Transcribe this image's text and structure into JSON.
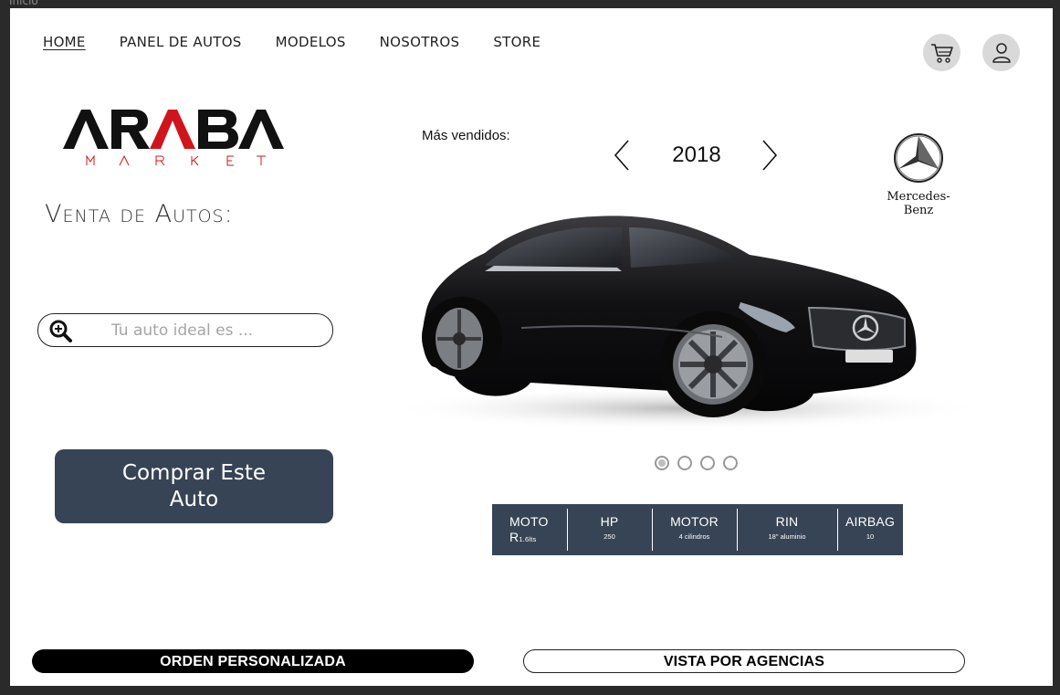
{
  "frame": {
    "label": "Inicio"
  },
  "nav": {
    "items": [
      {
        "label": "HOME",
        "active": true
      },
      {
        "label": "PANEL DE AUTOS",
        "active": false
      },
      {
        "label": "MODELOS",
        "active": false
      },
      {
        "label": "NOSOTROS",
        "active": false
      },
      {
        "label": "STORE",
        "active": false
      }
    ],
    "cart_icon": "cart-icon",
    "user_icon": "user-icon"
  },
  "logo": {
    "main": "ARABA",
    "sub": "MARKET",
    "accent_color": "#d0141b"
  },
  "hero": {
    "heading": "Venta de Autos:"
  },
  "search": {
    "placeholder": "Tu auto ideal es ...",
    "icon": "search-icon"
  },
  "buy_button": {
    "label": "Comprar Este Auto"
  },
  "carousel": {
    "section_label": "Más vendidos:",
    "year": "2018",
    "brand": "Mercedes-Benz",
    "dots": [
      true,
      false,
      false,
      false
    ]
  },
  "specs": [
    {
      "label": "MOTO",
      "label2": "R",
      "value": "1.6lts"
    },
    {
      "label": "HP",
      "value": "250"
    },
    {
      "label": "MOTOR",
      "value": "4 cilindros"
    },
    {
      "label": "RIN",
      "value": "18\" aluminio"
    },
    {
      "label": "AIRBAG",
      "value": "10"
    }
  ],
  "bottom": {
    "orden_label": "ORDEN PERSONALIZADA",
    "vista_label": "VISTA POR AGENCIAS"
  },
  "colors": {
    "primary": "#374455",
    "accent": "#d0141b"
  }
}
